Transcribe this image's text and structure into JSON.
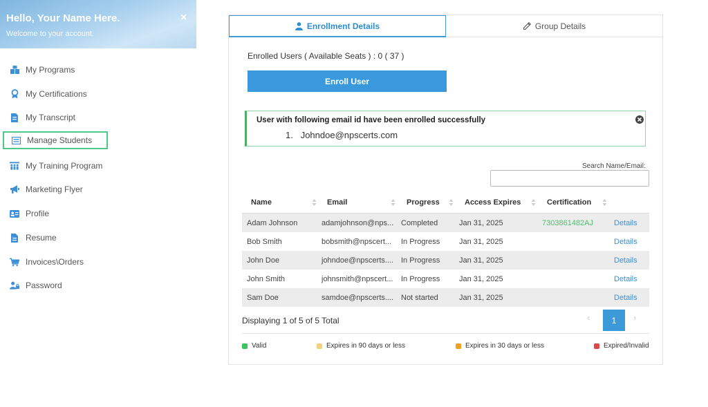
{
  "sidebar": {
    "greeting": "Hello, Your Name Here.",
    "welcome": "Welcome to your account.",
    "close": "×",
    "items": [
      {
        "label": "My Programs",
        "icon": "boxes-icon"
      },
      {
        "label": "My Certifications",
        "icon": "award-icon"
      },
      {
        "label": "My Transcript",
        "icon": "document-icon"
      },
      {
        "label": "Manage Students",
        "icon": "list-table-icon",
        "active": true
      },
      {
        "label": "My Training Program",
        "icon": "group-training-icon"
      },
      {
        "label": "Marketing Flyer",
        "icon": "megaphone-icon"
      },
      {
        "label": "Profile",
        "icon": "id-card-icon"
      },
      {
        "label": "Resume",
        "icon": "file-icon"
      },
      {
        "label": "Invoices\\Orders",
        "icon": "cart-icon"
      },
      {
        "label": "Password",
        "icon": "user-lock-icon"
      }
    ]
  },
  "tabs": {
    "enrollment": "Enrollment Details",
    "group": "Group Details"
  },
  "enroll": {
    "seats_text": "Enrolled Users ( Available Seats ) : 0 ( 37 )",
    "button": "Enroll User"
  },
  "alert": {
    "title": "User with following email id have been enrolled successfully",
    "item_number": "1.",
    "item_email": "Johndoe@npscerts.com"
  },
  "search": {
    "label": "Search Name/Email:",
    "value": ""
  },
  "table": {
    "headers": [
      "Name",
      "Email",
      "Progress",
      "Access Expires",
      "Certification"
    ],
    "rows": [
      {
        "name": "Adam Johnson",
        "email": "adamjohnson@nps...",
        "progress": "Completed",
        "expires": "Jan 31, 2025",
        "cert": "7303861482AJ",
        "action": "Details"
      },
      {
        "name": "Bob Smith",
        "email": "bobsmith@npscert...",
        "progress": "In Progress",
        "expires": "Jan 31, 2025",
        "cert": "",
        "action": "Details"
      },
      {
        "name": "John Doe",
        "email": "johndoe@npscerts....",
        "progress": "In Progress",
        "expires": "Jan 31, 2025",
        "cert": "",
        "action": "Details"
      },
      {
        "name": "John Smith",
        "email": "johnsmith@npscert...",
        "progress": "In Progress",
        "expires": "Jan 31, 2025",
        "cert": "",
        "action": "Details"
      },
      {
        "name": "Sam Doe",
        "email": "samdoe@npscerts....",
        "progress": "Not started",
        "expires": "Jan 31, 2025",
        "cert": "",
        "action": "Details"
      }
    ]
  },
  "pagination": {
    "displaying": "Displaying 1 of 5 of 5 Total",
    "prev": "‹",
    "current": "1",
    "next": "›"
  },
  "legend": [
    {
      "label": "Valid",
      "color": "#3cc25f"
    },
    {
      "label": "Expires in 90 days or less",
      "color": "#f5d27a"
    },
    {
      "label": "Expires in 30 days or less",
      "color": "#f2a021"
    },
    {
      "label": "Expired/Invalid",
      "color": "#e04848"
    }
  ],
  "colors": {
    "accent": "#3a99dc",
    "success_border": "#4caf63",
    "cert_text": "#4cc06c"
  }
}
